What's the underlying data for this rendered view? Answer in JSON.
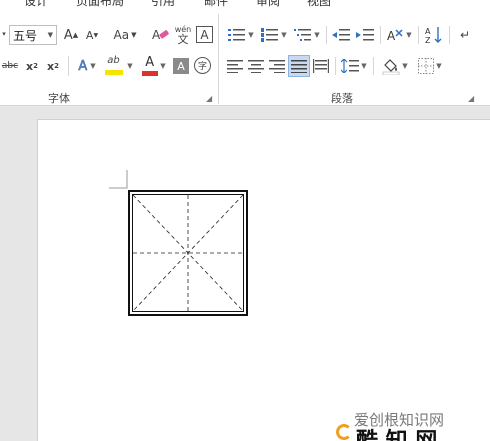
{
  "tabs": [
    "设计",
    "页面布局",
    "引用",
    "邮件",
    "审阅",
    "视图"
  ],
  "font": {
    "size_value": "五号",
    "grow_label": "A",
    "shrink_label": "A",
    "case_label": "Aa",
    "phonetic_top": "wén",
    "phonetic_bottom": "文",
    "border_char_label": "A",
    "strike_label": "abc",
    "subscript_base": "x",
    "subscript_mark": "2",
    "superscript_base": "x",
    "superscript_mark": "2",
    "effects_label": "A",
    "highlight_label": "ab",
    "font_color_label": "A",
    "shading_label": "A",
    "enclose_label": "字",
    "group_label": "字体",
    "highlight_color": "#f5e400",
    "font_color": "#e0302a"
  },
  "paragraph": {
    "group_label": "段落"
  },
  "watermark": {
    "line1": "爱创根知识网",
    "line2": "酷 知 网"
  }
}
